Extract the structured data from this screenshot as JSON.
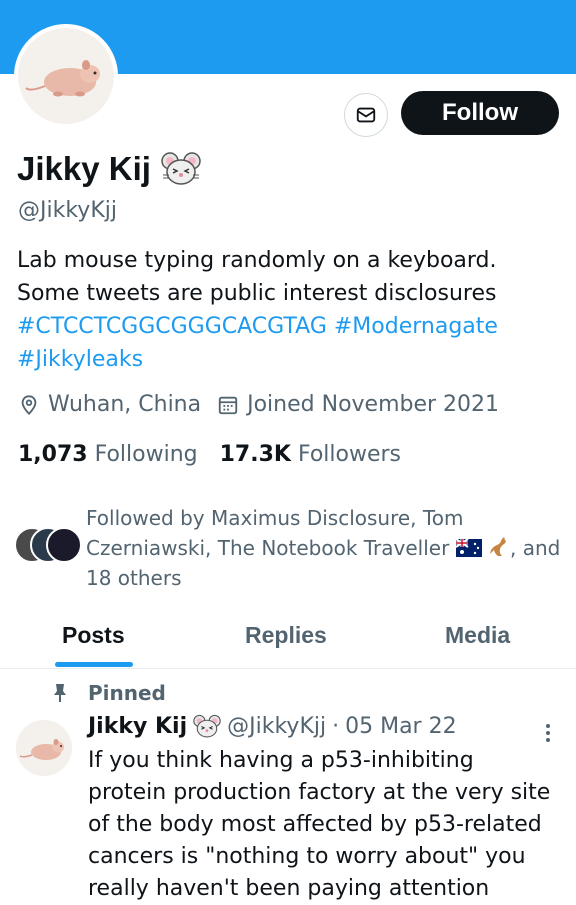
{
  "profile": {
    "name": "Jikky Kij",
    "handle": "@JikkyKjj",
    "follow_label": "Follow",
    "bio_line1": "Lab mouse typing randomly on a keyboard.",
    "bio_line2": "Some tweets are public interest disclosures",
    "hashtags": [
      "#CTCCTCGGCGGGCACGTAG",
      "#Modernagate",
      "#Jikkyleaks"
    ],
    "location": "Wuhan, China",
    "joined": "Joined November 2021",
    "following_count": "1,073",
    "following_label": "Following",
    "followers_count": "17.3K",
    "followers_label": "Followers",
    "followed_by_text": "Followed by Maximus Disclosure, Tom Czerniawski, The Notebook Traveller",
    "followed_by_suffix": ", and 18 others"
  },
  "tabs": [
    "Posts",
    "Replies",
    "Media"
  ],
  "post": {
    "pinned_label": "Pinned",
    "author": "Jikky Kij",
    "handle": "@JikkyKjj",
    "separator": "·",
    "date": "05 Mar 22",
    "text": "If you think having a p53-inhibiting protein production factory at the very site of the body most affected by p53-related cancers is \"nothing to worry about\" you really haven't been paying attention"
  },
  "colors": {
    "banner": "#1d9bf0",
    "accent": "#1d9bf0",
    "follow_button": "#0f1419",
    "secondary_text": "#536471"
  },
  "icons": [
    "mouse-face-icon",
    "envelope-icon",
    "location-pin-icon",
    "calendar-icon",
    "pushpin-icon",
    "more-vertical-icon",
    "australia-flag-icon",
    "kangaroo-icon"
  ]
}
